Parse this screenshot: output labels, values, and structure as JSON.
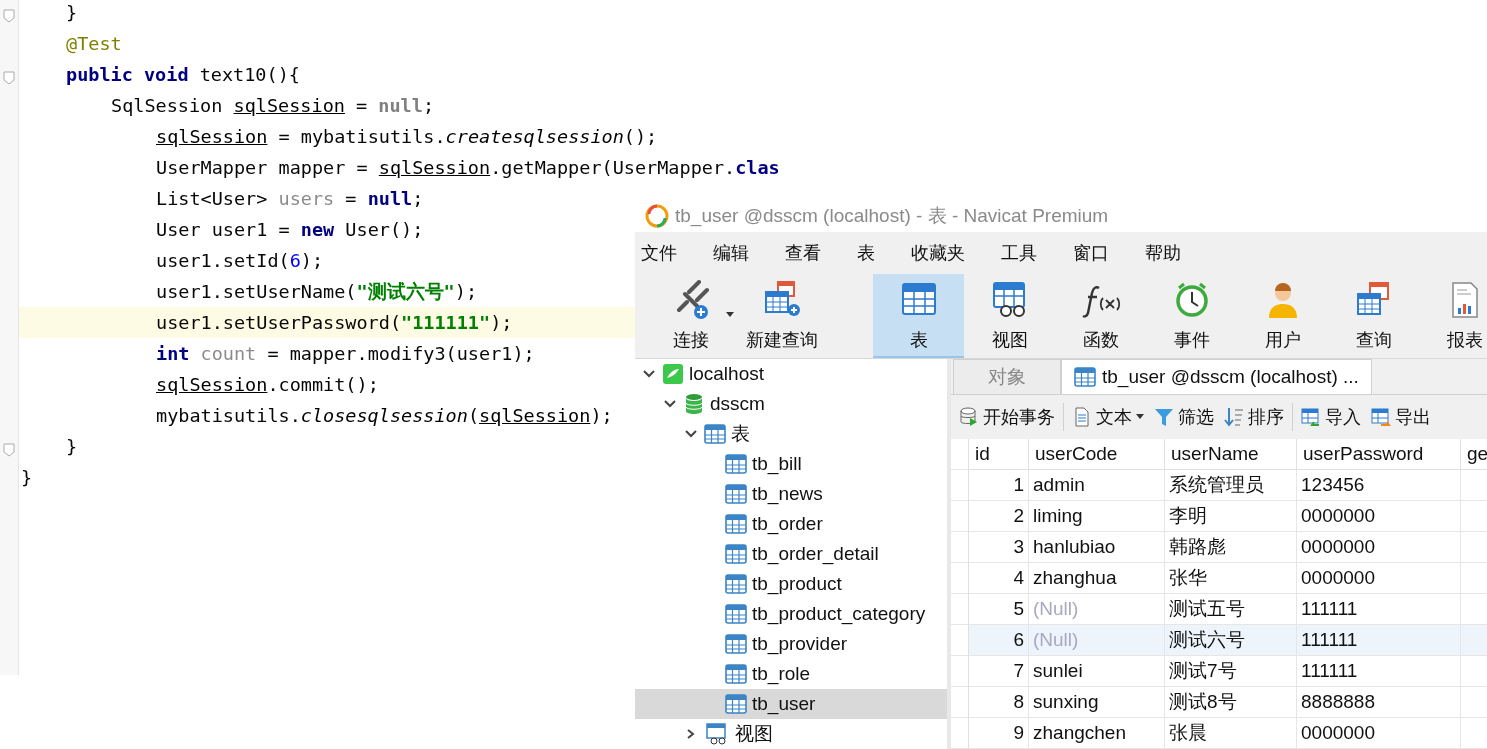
{
  "editor": {
    "lines": [
      {
        "children": [
          {
            "highlighted": false,
            "tokens": [
              {
                "text": "}",
                "kind": "plain"
              }
            ]
          },
          {
            "highlighted": false,
            "tokens": [
              {
                "text": "@Test",
                "kind": "annotation"
              }
            ]
          },
          {
            "highlighted": false,
            "tokens": [
              {
                "text": "public",
                "kind": "keyword"
              },
              {
                "text": " void",
                "kind": "keyword"
              },
              {
                "text": " text10(){",
                "kind": "plain"
              }
            ],
            "children": [
              {
                "highlighted": false,
                "tokens": [
                  {
                    "text": "SqlSession ",
                    "kind": "plain"
                  },
                  {
                    "text": "sqlSession",
                    "kind": "reassigned"
                  },
                  {
                    "text": " = ",
                    "kind": "plain"
                  },
                  {
                    "text": "null",
                    "kind": "redundant"
                  },
                  {
                    "text": ";",
                    "kind": "plain"
                  }
                ],
                "children": [
                  {
                    "highlighted": false,
                    "tokens": [
                      {
                        "text": "sqlSession",
                        "kind": "reassigned"
                      },
                      {
                        "text": " = mybatisutils.",
                        "kind": "plain"
                      },
                      {
                        "text": "createsqlsession",
                        "kind": "static"
                      },
                      {
                        "text": "();",
                        "kind": "plain"
                      }
                    ]
                  },
                  {
                    "highlighted": false,
                    "tokens": [
                      {
                        "text": "UserMapper mapper = ",
                        "kind": "plain"
                      },
                      {
                        "text": "sqlSession",
                        "kind": "reassigned"
                      },
                      {
                        "text": ".getMapper(UserMapper.",
                        "kind": "plain"
                      },
                      {
                        "text": "clas",
                        "kind": "keyword"
                      }
                    ]
                  },
                  {
                    "highlighted": false,
                    "tokens": [
                      {
                        "text": "List<User> ",
                        "kind": "plain"
                      },
                      {
                        "text": "users",
                        "kind": "unused"
                      },
                      {
                        "text": " = ",
                        "kind": "plain"
                      },
                      {
                        "text": "null",
                        "kind": "keyword"
                      },
                      {
                        "text": ";",
                        "kind": "plain"
                      }
                    ]
                  },
                  {
                    "highlighted": false,
                    "tokens": [
                      {
                        "text": "User user1 = ",
                        "kind": "plain"
                      },
                      {
                        "text": "new",
                        "kind": "keyword"
                      },
                      {
                        "text": " User();",
                        "kind": "plain"
                      }
                    ]
                  },
                  {
                    "highlighted": false,
                    "tokens": [
                      {
                        "text": "user1.setId(",
                        "kind": "plain"
                      },
                      {
                        "text": "6",
                        "kind": "number"
                      },
                      {
                        "text": ");",
                        "kind": "plain"
                      }
                    ]
                  },
                  {
                    "highlighted": false,
                    "tokens": [
                      {
                        "text": "user1.setUserName(",
                        "kind": "plain"
                      },
                      {
                        "text": "\"测试六号\"",
                        "kind": "string"
                      },
                      {
                        "text": ");",
                        "kind": "plain"
                      }
                    ]
                  },
                  {
                    "highlighted": true,
                    "tokens": [
                      {
                        "text": "user1.setUserPassword(",
                        "kind": "plain"
                      },
                      {
                        "text": "\"111111\"",
                        "kind": "string"
                      },
                      {
                        "text": ");",
                        "kind": "plain"
                      }
                    ]
                  },
                  {
                    "highlighted": false,
                    "tokens": [
                      {
                        "text": "int",
                        "kind": "keyword"
                      },
                      {
                        "text": " count",
                        "kind": "unused"
                      },
                      {
                        "text": " = mapper.modify3(user1);",
                        "kind": "plain"
                      }
                    ]
                  },
                  {
                    "highlighted": false,
                    "tokens": [
                      {
                        "text": "sqlSession",
                        "kind": "reassigned"
                      },
                      {
                        "text": ".commit();",
                        "kind": "plain"
                      }
                    ]
                  },
                  {
                    "highlighted": false,
                    "tokens": [
                      {
                        "text": "mybatisutils.",
                        "kind": "plain"
                      },
                      {
                        "text": "closesqlsession",
                        "kind": "static"
                      },
                      {
                        "text": "(",
                        "kind": "plain"
                      },
                      {
                        "text": "sqlSession",
                        "kind": "reassigned"
                      },
                      {
                        "text": ");",
                        "kind": "plain"
                      }
                    ]
                  }
                ]
              }
            ]
          },
          {
            "highlighted": false,
            "tokens": [
              {
                "text": "}",
                "kind": "plain"
              }
            ]
          }
        ]
      },
      {
        "highlighted": false,
        "tokens": [
          {
            "text": "}",
            "kind": "plain"
          }
        ]
      }
    ]
  },
  "navicat": {
    "window": {
      "title": "tb_user @dsscm (localhost) - 表 - Navicat Premium"
    },
    "menu": [
      "文件",
      "编辑",
      "查看",
      "表",
      "收藏夹",
      "工具",
      "窗口",
      "帮助"
    ],
    "toolbar": {
      "left": [
        {
          "label": "连接",
          "kind": "connect",
          "selected": false,
          "dropdown": true
        },
        {
          "label": "新建查询",
          "kind": "new-query",
          "selected": false,
          "dropdown": false
        }
      ],
      "right": [
        {
          "label": "表",
          "kind": "table",
          "selected": true,
          "dropdown": false
        },
        {
          "label": "视图",
          "kind": "view",
          "selected": false,
          "dropdown": false
        },
        {
          "label": "函数",
          "kind": "function",
          "selected": false,
          "dropdown": false
        },
        {
          "label": "事件",
          "kind": "event",
          "selected": false,
          "dropdown": false
        },
        {
          "label": "用户",
          "kind": "user",
          "selected": false,
          "dropdown": false
        },
        {
          "label": "查询",
          "kind": "query",
          "selected": false,
          "dropdown": false
        },
        {
          "label": "报表",
          "kind": "report",
          "selected": false,
          "dropdown": false
        }
      ]
    },
    "tree": [
      {
        "label": "localhost",
        "kind": "connection",
        "expanded": true,
        "selected": false,
        "children": [
          {
            "label": "dsscm",
            "kind": "database",
            "expanded": true,
            "selected": false,
            "children": [
              {
                "label": "表",
                "kind": "table-folder",
                "expanded": true,
                "selected": false,
                "children": [
                  {
                    "label": "tb_bill",
                    "kind": "table",
                    "selected": false
                  },
                  {
                    "label": "tb_news",
                    "kind": "table",
                    "selected": false
                  },
                  {
                    "label": "tb_order",
                    "kind": "table",
                    "selected": false
                  },
                  {
                    "label": "tb_order_detail",
                    "kind": "table",
                    "selected": false
                  },
                  {
                    "label": "tb_product",
                    "kind": "table",
                    "selected": false
                  },
                  {
                    "label": "tb_product_category",
                    "kind": "table",
                    "selected": false
                  },
                  {
                    "label": "tb_provider",
                    "kind": "table",
                    "selected": false
                  },
                  {
                    "label": "tb_role",
                    "kind": "table",
                    "selected": false
                  },
                  {
                    "label": "tb_user",
                    "kind": "table",
                    "selected": true
                  }
                ]
              },
              {
                "label": "视图",
                "kind": "view-folder",
                "expanded": false,
                "selected": false
              }
            ]
          }
        ]
      }
    ],
    "tabs": [
      {
        "label": "对象",
        "kind": "objects",
        "selected": false
      },
      {
        "label": "tb_user @dsscm (localhost) ...",
        "kind": "table",
        "selected": true
      }
    ],
    "data_toolbar": [
      [
        {
          "label": "开始事务",
          "kind": "transaction",
          "dropdown": false
        }
      ],
      [
        {
          "label": "文本",
          "kind": "text",
          "dropdown": true
        },
        {
          "label": "筛选",
          "kind": "filter",
          "dropdown": false
        },
        {
          "label": "排序",
          "kind": "sort",
          "dropdown": false
        }
      ],
      [
        {
          "label": "导入",
          "kind": "import",
          "dropdown": false
        },
        {
          "label": "导出",
          "kind": "export",
          "dropdown": false
        }
      ]
    ],
    "table": {
      "columns": [
        "id",
        "userCode",
        "userName",
        "userPassword",
        "ge"
      ],
      "rows": [
        {
          "id": "1",
          "user_code": "admin",
          "user_code_null": false,
          "user_name": "系统管理员",
          "user_password": "123456",
          "selected": false
        },
        {
          "id": "2",
          "user_code": "liming",
          "user_code_null": false,
          "user_name": "李明",
          "user_password": "0000000",
          "selected": false
        },
        {
          "id": "3",
          "user_code": "hanlubiao",
          "user_code_null": false,
          "user_name": "韩路彪",
          "user_password": "0000000",
          "selected": false
        },
        {
          "id": "4",
          "user_code": "zhanghua",
          "user_code_null": false,
          "user_name": "张华",
          "user_password": "0000000",
          "selected": false
        },
        {
          "id": "5",
          "user_code": "(Null)",
          "user_code_null": true,
          "user_name": "测试五号",
          "user_password": "111111",
          "selected": false
        },
        {
          "id": "6",
          "user_code": "(Null)",
          "user_code_null": true,
          "user_name": "测试六号",
          "user_password": "111111",
          "selected": true
        },
        {
          "id": "7",
          "user_code": "sunlei",
          "user_code_null": false,
          "user_name": "测试7号",
          "user_password": "111111",
          "selected": false
        },
        {
          "id": "8",
          "user_code": "sunxing",
          "user_code_null": false,
          "user_name": "测试8号",
          "user_password": "8888888",
          "selected": false
        },
        {
          "id": "9",
          "user_code": "zhangchen",
          "user_code_null": false,
          "user_name": "张晨",
          "user_password": "0000000",
          "selected": false
        }
      ]
    }
  }
}
